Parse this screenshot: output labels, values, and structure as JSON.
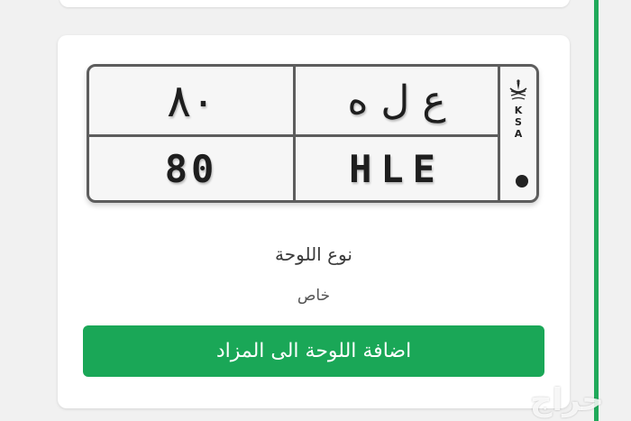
{
  "plate": {
    "arabic_numbers": "٨٠",
    "arabic_letters": "ع ل ه",
    "english_numbers": "80",
    "english_letters": "HLE",
    "country_code": [
      "K",
      "S",
      "A"
    ]
  },
  "details": {
    "type_label": "نوع اللوحة",
    "type_value": "خاص"
  },
  "actions": {
    "add_to_auction": "اضافة اللوحة الى المزاد"
  },
  "watermark": "حراج",
  "colors": {
    "accent": "#1aa757",
    "stripe": "#20a95a",
    "plate_border": "#5d5d5d"
  }
}
